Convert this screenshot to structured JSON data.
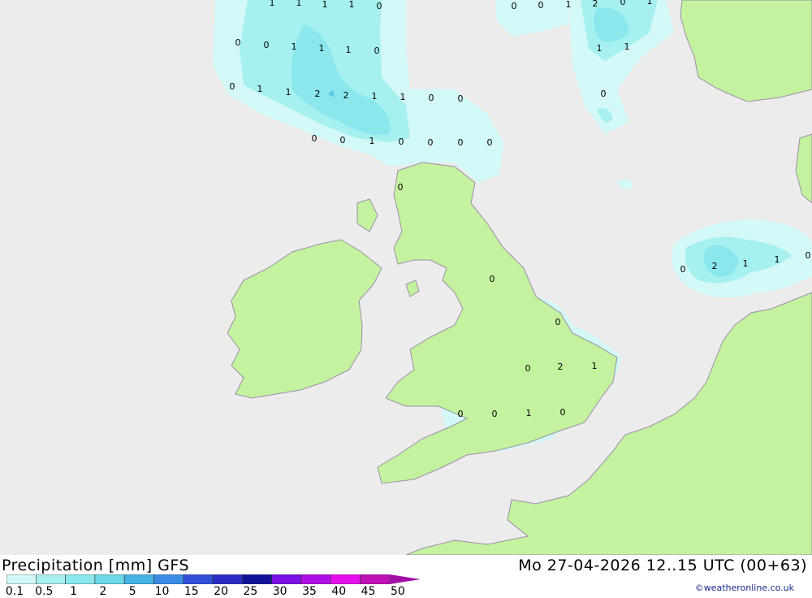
{
  "map": {
    "colors": {
      "sea": "#ececec",
      "land": "#c4f29e",
      "border": "#9a8fa8",
      "precip_light": "#d2f8f8",
      "precip_mid": "#a6f0f0",
      "precip_high": "#8ae8ec"
    },
    "value_labels": [
      {
        "text": "1"
      },
      {
        "text": "1"
      },
      {
        "text": "1"
      },
      {
        "text": "1"
      },
      {
        "text": "0"
      },
      {
        "text": "0"
      },
      {
        "text": "0"
      },
      {
        "text": "1"
      },
      {
        "text": "1"
      },
      {
        "text": "1"
      },
      {
        "text": "0"
      },
      {
        "text": "0"
      },
      {
        "text": "1"
      },
      {
        "text": "1"
      },
      {
        "text": "2"
      },
      {
        "text": "2"
      },
      {
        "text": "1"
      },
      {
        "text": "1"
      },
      {
        "text": "0"
      },
      {
        "text": "0"
      },
      {
        "text": "0"
      },
      {
        "text": "0"
      },
      {
        "text": "1"
      },
      {
        "text": "0"
      },
      {
        "text": "0"
      },
      {
        "text": "0"
      },
      {
        "text": "0"
      },
      {
        "text": "0"
      },
      {
        "text": "1"
      },
      {
        "text": "0"
      },
      {
        "text": "0"
      },
      {
        "text": "2"
      },
      {
        "text": "0"
      },
      {
        "text": "1"
      },
      {
        "text": "1"
      },
      {
        "text": "1"
      },
      {
        "text": "0"
      },
      {
        "text": "0"
      },
      {
        "text": "2"
      },
      {
        "text": "1"
      },
      {
        "text": "1"
      },
      {
        "text": "0"
      },
      {
        "text": "0"
      },
      {
        "text": "0"
      },
      {
        "text": "0"
      },
      {
        "text": "2"
      },
      {
        "text": "1"
      },
      {
        "text": "0"
      },
      {
        "text": "0"
      },
      {
        "text": "1"
      },
      {
        "text": "0"
      }
    ]
  },
  "footer": {
    "title": "Precipitation [mm] GFS",
    "datetime": "Mo 27-04-2026 12..15 UTC (00+63)",
    "credit": "©weatheronline.co.uk",
    "scale_labels": [
      "0.1",
      "0.5",
      "1",
      "2",
      "5",
      "10",
      "15",
      "20",
      "25",
      "30",
      "35",
      "40",
      "45",
      "50"
    ],
    "scale_colors": [
      "#d2f8f8",
      "#aaf0f0",
      "#8ae8ec",
      "#6ad8e8",
      "#46b4e6",
      "#3a8ce6",
      "#3050da",
      "#2a2cc8",
      "#12129a",
      "#7a10e6",
      "#b00ee8",
      "#e80ef0",
      "#c010b8"
    ]
  }
}
